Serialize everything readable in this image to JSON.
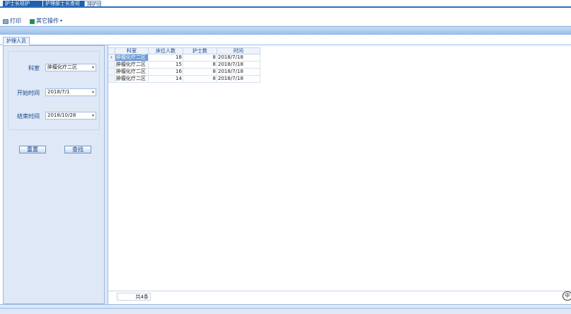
{
  "doc_tabs": [
    {
      "label": "护士长班护"
    },
    {
      "label": "护理部士长查班"
    },
    {
      "label": "排护比"
    }
  ],
  "toolbar": {
    "print_label": "打印",
    "other_label": "其它操作",
    "print_icon": "printer-icon",
    "other_icon": "export-icon"
  },
  "panel_tab": {
    "label": "护理人员"
  },
  "filters": {
    "dept": {
      "label": "科室",
      "value": "肿瘤化疗二区"
    },
    "start": {
      "label": "开始时间",
      "value": "2018/7/1"
    },
    "end": {
      "label": "结束时间",
      "value": "2018/10/28"
    }
  },
  "buttons": {
    "reset": "重置",
    "search": "查找"
  },
  "grid": {
    "columns": [
      "科室",
      "床位人数",
      "护士数",
      "时间"
    ],
    "rows": [
      {
        "dept": "肿瘤化疗二区",
        "beds": "18",
        "nurses": "8",
        "time": "2018/7/18"
      },
      {
        "dept": "肿瘤化疗二区",
        "beds": "15",
        "nurses": "8",
        "time": "2018/7/18"
      },
      {
        "dept": "肿瘤化疗二区",
        "beds": "16",
        "nurses": "8",
        "time": "2018/7/18"
      },
      {
        "dept": "肿瘤化疗二区",
        "beds": "14",
        "nurses": "8",
        "time": "2018/7/18"
      }
    ],
    "selected_row": 0,
    "footer_count": "共4条"
  },
  "corner_icon_text": "中"
}
